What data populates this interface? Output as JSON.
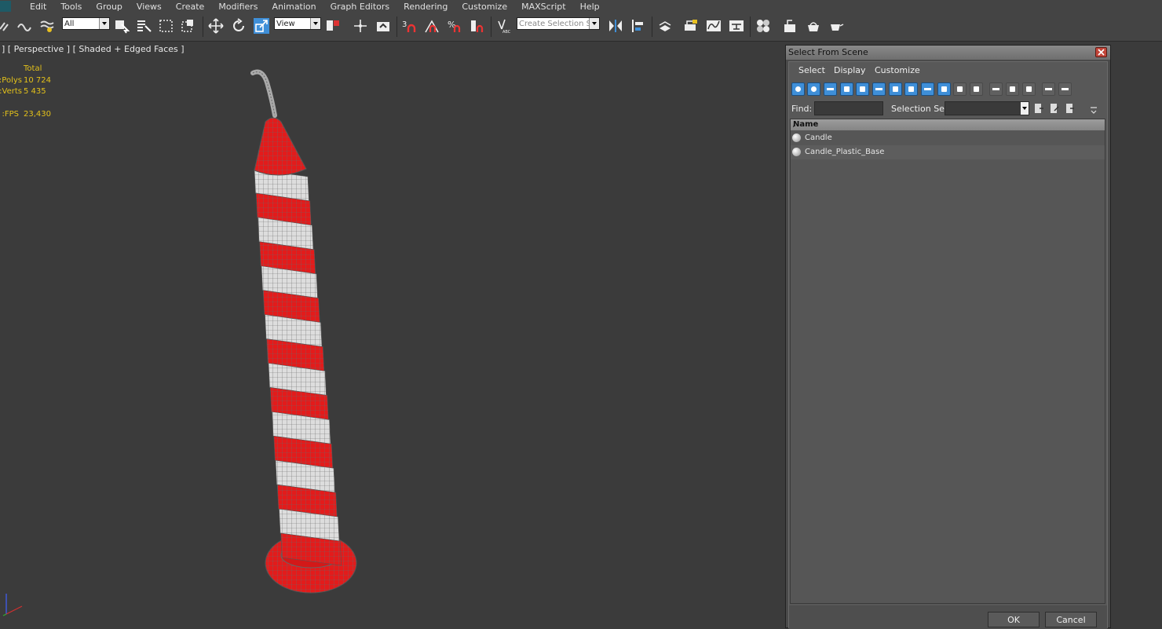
{
  "menubar": {
    "items": [
      "Edit",
      "Tools",
      "Group",
      "Views",
      "Create",
      "Modifiers",
      "Animation",
      "Graph Editors",
      "Rendering",
      "Customize",
      "MAXScript",
      "Help"
    ]
  },
  "toolbar": {
    "filter_value": "All",
    "reference_coord_value": "View",
    "selection_set_placeholder": "Create Selection Se",
    "snap_label": "3"
  },
  "viewport": {
    "label": "] [ Perspective ] [ Shaded + Edged Faces ]",
    "stats": {
      "header": "Total",
      "polys_label": "Polys:",
      "polys_value": "10 724",
      "verts_label": "Verts:",
      "verts_value": "5 435",
      "fps_label": "FPS:",
      "fps_value": "23,430"
    },
    "candle_colors": {
      "red": "#e31b1b",
      "white": "#dddddd"
    }
  },
  "dialog": {
    "title": "Select From Scene",
    "menu": [
      "Select",
      "Display",
      "Customize"
    ],
    "find_label": "Find:",
    "find_value": "",
    "selection_set_label": "Selection Set:",
    "list_header": "Name",
    "sort_indicator": "/",
    "items": [
      "Candle",
      "Candle_Plastic_Base"
    ],
    "ok_label": "OK",
    "cancel_label": "Cancel"
  }
}
